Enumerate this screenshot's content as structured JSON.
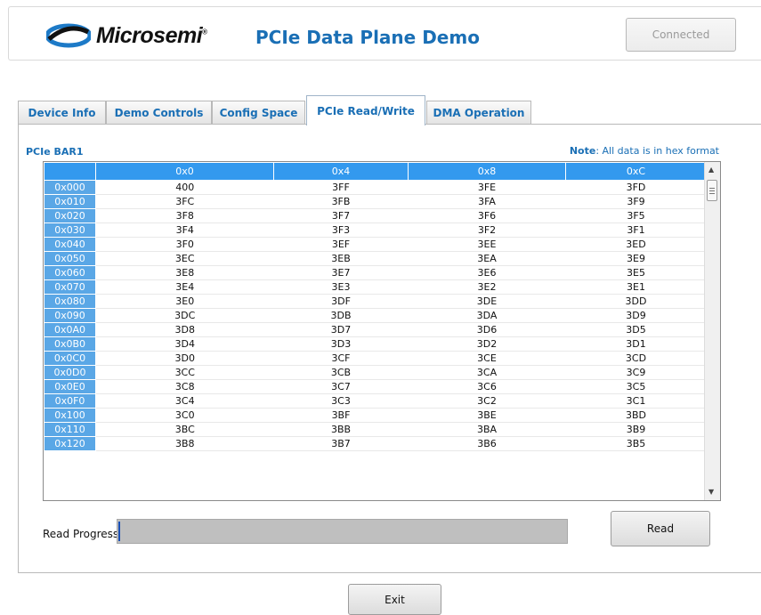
{
  "header": {
    "logo_text": "Microsemi",
    "logo_mark": "®",
    "title": "PCIe Data Plane Demo",
    "connection_status": "Connected"
  },
  "tabs": [
    {
      "label": "Device Info",
      "active": false
    },
    {
      "label": "Demo Controls",
      "active": false
    },
    {
      "label": "Config Space",
      "active": false
    },
    {
      "label": "PCIe Read/Write",
      "active": true
    },
    {
      "label": "DMA Operation",
      "active": false
    }
  ],
  "bar_label": "PCIe BAR1",
  "note": {
    "prefix": "Note",
    "text": ": All data is in hex format"
  },
  "grid": {
    "columns": [
      "0x0",
      "0x4",
      "0x8",
      "0xC"
    ],
    "rows": [
      {
        "addr": "0x000",
        "cells": [
          "400",
          "3FF",
          "3FE",
          "3FD"
        ]
      },
      {
        "addr": "0x010",
        "cells": [
          "3FC",
          "3FB",
          "3FA",
          "3F9"
        ]
      },
      {
        "addr": "0x020",
        "cells": [
          "3F8",
          "3F7",
          "3F6",
          "3F5"
        ]
      },
      {
        "addr": "0x030",
        "cells": [
          "3F4",
          "3F3",
          "3F2",
          "3F1"
        ]
      },
      {
        "addr": "0x040",
        "cells": [
          "3F0",
          "3EF",
          "3EE",
          "3ED"
        ]
      },
      {
        "addr": "0x050",
        "cells": [
          "3EC",
          "3EB",
          "3EA",
          "3E9"
        ]
      },
      {
        "addr": "0x060",
        "cells": [
          "3E8",
          "3E7",
          "3E6",
          "3E5"
        ]
      },
      {
        "addr": "0x070",
        "cells": [
          "3E4",
          "3E3",
          "3E2",
          "3E1"
        ]
      },
      {
        "addr": "0x080",
        "cells": [
          "3E0",
          "3DF",
          "3DE",
          "3DD"
        ]
      },
      {
        "addr": "0x090",
        "cells": [
          "3DC",
          "3DB",
          "3DA",
          "3D9"
        ]
      },
      {
        "addr": "0x0A0",
        "cells": [
          "3D8",
          "3D7",
          "3D6",
          "3D5"
        ]
      },
      {
        "addr": "0x0B0",
        "cells": [
          "3D4",
          "3D3",
          "3D2",
          "3D1"
        ]
      },
      {
        "addr": "0x0C0",
        "cells": [
          "3D0",
          "3CF",
          "3CE",
          "3CD"
        ]
      },
      {
        "addr": "0x0D0",
        "cells": [
          "3CC",
          "3CB",
          "3CA",
          "3C9"
        ]
      },
      {
        "addr": "0x0E0",
        "cells": [
          "3C8",
          "3C7",
          "3C6",
          "3C5"
        ]
      },
      {
        "addr": "0x0F0",
        "cells": [
          "3C4",
          "3C3",
          "3C2",
          "3C1"
        ]
      },
      {
        "addr": "0x100",
        "cells": [
          "3C0",
          "3BF",
          "3BE",
          "3BD"
        ]
      },
      {
        "addr": "0x110",
        "cells": [
          "3BC",
          "3BB",
          "3BA",
          "3B9"
        ]
      },
      {
        "addr": "0x120",
        "cells": [
          "3B8",
          "3B7",
          "3B6",
          "3B5"
        ]
      }
    ]
  },
  "progress": {
    "label": "Read Progress",
    "value_percent": 0
  },
  "buttons": {
    "read": "Read",
    "exit": "Exit"
  },
  "colors": {
    "accent": "#1a6fb5",
    "header_blue": "#3399ee",
    "row_head_blue": "#5aa7e6"
  }
}
